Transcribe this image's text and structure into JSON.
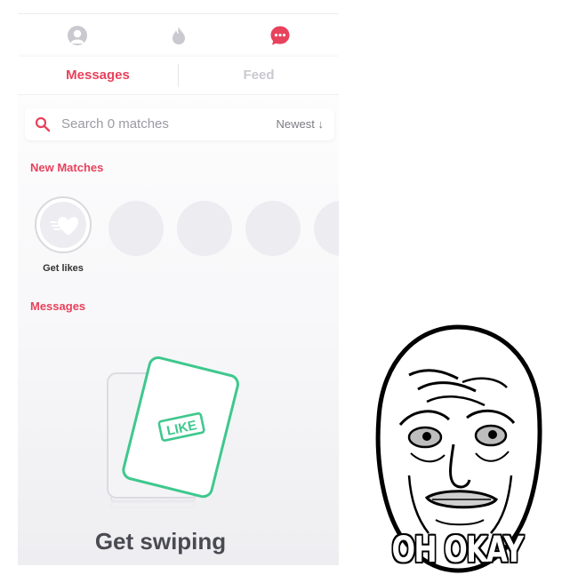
{
  "navbar": {
    "icons": [
      "profile-icon",
      "flame-icon",
      "chat-icon"
    ],
    "active_color": "#e8425c",
    "inactive_color": "#c9c9cf"
  },
  "tabs": [
    {
      "label": "Messages",
      "active": true
    },
    {
      "label": "Feed",
      "active": false
    }
  ],
  "search": {
    "placeholder": "Search 0 matches",
    "sort_label": "Newest ↓"
  },
  "new_matches": {
    "heading": "New Matches",
    "get_likes_label": "Get likes"
  },
  "messages": {
    "heading": "Messages",
    "card_label": "LIKE",
    "empty_title": "Get swiping"
  },
  "meme": {
    "caption": "OH OKAY"
  },
  "colors": {
    "accent": "#e8425c",
    "like_green": "#3ec88d"
  }
}
